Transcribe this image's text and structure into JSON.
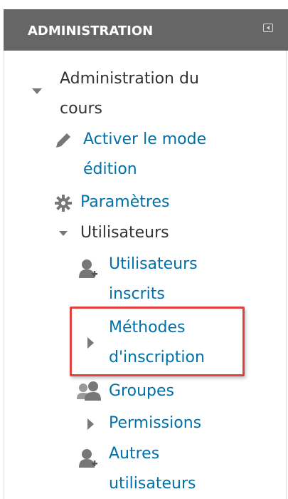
{
  "block": {
    "title": "ADMINISTRATION",
    "collapse_icon": "collapse-left-icon"
  },
  "tree": {
    "course_admin": {
      "line1": "Administration du",
      "line2": "cours",
      "icon": "caret-down-icon"
    },
    "edit_mode": {
      "line1": "Activer le mode",
      "line2": "édition",
      "icon": "pencil-icon"
    },
    "settings": {
      "label": "Paramètres",
      "icon": "gear-icon"
    },
    "users": {
      "label": "Utilisateurs",
      "icon": "caret-down-icon"
    },
    "enrolled_users": {
      "line1": "Utilisateurs",
      "line2": "inscrits",
      "icon": "user-add-icon"
    },
    "enrolment_methods": {
      "line1": "Méthodes",
      "line2": "d'inscription",
      "icon": "caret-right-icon"
    },
    "groups": {
      "label": "Groupes",
      "icon": "group-icon"
    },
    "permissions": {
      "label": "Permissions",
      "icon": "caret-right-icon"
    },
    "other_users": {
      "line1": "Autres",
      "line2": "utilisateurs",
      "icon": "user-add-icon"
    }
  },
  "colors": {
    "header_bg": "#666666",
    "link": "#0070a8",
    "text": "#333333",
    "highlight": "#e0413e"
  }
}
